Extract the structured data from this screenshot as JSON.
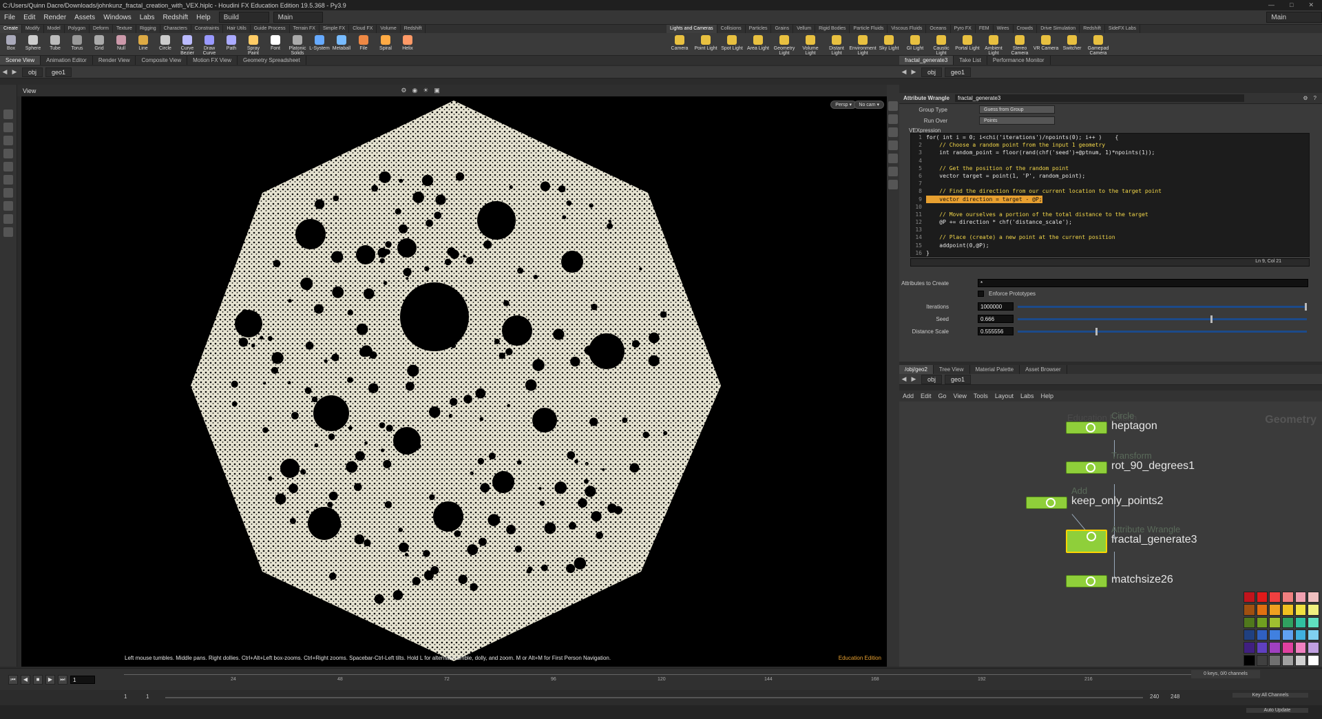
{
  "titlebar": {
    "title": "C:/Users/Quinn Dacre/Downloads/johnkunz_fractal_creation_with_VEX.hiplc - Houdini FX Education Edition 19.5.368 - Py3.9"
  },
  "menu": {
    "items": [
      "File",
      "Edit",
      "Render",
      "Assets",
      "Windows",
      "Labs",
      "Redshift",
      "Help"
    ],
    "desktop": "Build",
    "main": "Main",
    "right": "Main"
  },
  "shelf_tabs_left": [
    "Create",
    "Modify",
    "Model",
    "Polygon",
    "Deform",
    "Texture",
    "Rigging",
    "Characters",
    "Constraints",
    "Hair Utils",
    "Guide Process",
    "Terrain FX",
    "Simple FX",
    "Cloud FX",
    "Volume",
    "Redshift"
  ],
  "shelf_tabs_right": [
    "Lights and Cameras",
    "Collisions",
    "Particles",
    "Grains",
    "Vellum",
    "Rigid Bodies",
    "Particle Fluids",
    "Viscous Fluids",
    "Oceans",
    "Pyro FX",
    "FEM",
    "Wires",
    "Crowds",
    "Drive Simulation",
    "Redshift",
    "SideFX Labs"
  ],
  "tools_left": [
    "Box",
    "Sphere",
    "Tube",
    "Torus",
    "Grid",
    "Null",
    "Line",
    "Circle",
    "Curve Bezier",
    "Draw Curve",
    "Path",
    "Spray Paint",
    "Font",
    "Platonic Solids",
    "L-System",
    "Metaball",
    "File",
    "Spiral",
    "Helix"
  ],
  "tools_right": [
    "Camera",
    "Point Light",
    "Spot Light",
    "Area Light",
    "Geometry Light",
    "Volume Light",
    "Distant Light",
    "Environment Light",
    "Sky Light",
    "GI Light",
    "Caustic Light",
    "Portal Light",
    "Ambient Light",
    "Stereo Camera",
    "VR Camera",
    "Switcher",
    "Gamepad Camera"
  ],
  "pane_tabs_left": [
    "Scene View",
    "Animation Editor",
    "Render View",
    "Composite View",
    "Motion FX View",
    "Geometry Spreadsheet"
  ],
  "pane_tabs_right": [
    "fractal_generate3",
    "Take List",
    "Performance Monitor"
  ],
  "pane_tabs_net": [
    "/obj/geo2",
    "Tree View",
    "Material Palette",
    "Asset Browser"
  ],
  "path": {
    "obj": "obj",
    "geo": "geo1"
  },
  "viewport": {
    "label": "View",
    "persp": "Persp",
    "cam": "No cam",
    "hint": "Left mouse tumbles. Middle pans. Right dollies. Ctrl+Alt+Left box-zooms. Ctrl+Right zooms. Spacebar-Ctrl-Left tilts. Hold L for alternate tumble, dolly, and zoom.    M or Alt+M for First Person Navigation.",
    "edition": "Education Edition"
  },
  "params": {
    "node_type": "Attribute Wrangle",
    "node_name": "fractal_generate3",
    "group_type_label": "Group Type",
    "group_type": "Guess from Group",
    "run_over_label": "Run Over",
    "run_over": "Points",
    "vex_label": "VEXpression",
    "cursor": "Ln 9, Col 21",
    "attrs_label": "Attributes to Create",
    "attrs": "*",
    "enforce_label": "Enforce Prototypes",
    "iter_label": "Iterations",
    "iter": "1000000",
    "iter_frac": 1.0,
    "seed_label": "Seed",
    "seed": "0.666",
    "seed_frac": 0.666,
    "dist_label": "Distance Scale",
    "dist": "0.555556",
    "dist_frac": 0.27
  },
  "code": [
    {
      "n": "1",
      "t": "for( int i = 0; i<chi('iterations')/npoints(0); i++ )    {",
      "c": false
    },
    {
      "n": "2",
      "t": "    // Choose a random point from the input 1 geometry",
      "c": true
    },
    {
      "n": "3",
      "t": "    int random_point = floor(rand(chf('seed')+@ptnum, 1)*npoints(1));",
      "c": false
    },
    {
      "n": "4",
      "t": "",
      "c": false
    },
    {
      "n": "5",
      "t": "    // Get the position of the random point",
      "c": true
    },
    {
      "n": "6",
      "t": "    vector target = point(1, 'P', random_point);",
      "c": false
    },
    {
      "n": "7",
      "t": "",
      "c": false
    },
    {
      "n": "8",
      "t": "    // Find the direction from our current location to the target point",
      "c": true
    },
    {
      "n": "9",
      "t": "    vector direction = target - @P;",
      "c": false,
      "h": true
    },
    {
      "n": "10",
      "t": "",
      "c": false
    },
    {
      "n": "11",
      "t": "    // Move ourselves a portion of the total distance to the target",
      "c": true
    },
    {
      "n": "12",
      "t": "    @P += direction * chf('distance_scale');",
      "c": false
    },
    {
      "n": "13",
      "t": "",
      "c": false
    },
    {
      "n": "14",
      "t": "    // Place (create) a new point at the current position",
      "c": true
    },
    {
      "n": "15",
      "t": "    addpoint(0,@P);",
      "c": false
    },
    {
      "n": "16",
      "t": "}",
      "c": false
    }
  ],
  "network": {
    "menu": [
      "Add",
      "Edit",
      "Go",
      "View",
      "Tools",
      "Layout",
      "Labs",
      "Help"
    ],
    "watermark": "Education Edition",
    "context": "Geometry",
    "nodes": [
      {
        "type": "Circle",
        "name": "heptagon"
      },
      {
        "type": "Transform",
        "name": "rot_90_degrees1"
      },
      {
        "type": "Add",
        "name": "keep_only_points2"
      },
      {
        "type": "Attribute Wrangle",
        "name": "fractal_generate3"
      },
      {
        "type": "",
        "name": "matchsize26"
      }
    ]
  },
  "palette": [
    "#c0141c",
    "#e01a1a",
    "#f04040",
    "#f08080",
    "#f0a0b0",
    "#f0c0c0",
    "#a05010",
    "#e07010",
    "#f0a020",
    "#f0c020",
    "#f0e040",
    "#f0f080",
    "#50781c",
    "#70a020",
    "#a0c030",
    "#30a060",
    "#30c0a0",
    "#60e0c0",
    "#204080",
    "#3060c0",
    "#4080e0",
    "#60a0f0",
    "#40b0e0",
    "#80d0f0",
    "#402080",
    "#6040c0",
    "#a040c0",
    "#e040a0",
    "#f080c0",
    "#c0a0e0",
    "#000000",
    "#404040",
    "#707070",
    "#a0a0a0",
    "#d0d0d0",
    "#ffffff"
  ],
  "timeline": {
    "frame": "1",
    "start": "1",
    "start2": "1",
    "end": "240",
    "end2": "248",
    "ticks": [
      "24",
      "48",
      "72",
      "96",
      "120",
      "144",
      "168",
      "192",
      "216"
    ],
    "keys": "0 keys, 0/0 channels",
    "key_all": "Key All Channels",
    "auto_update": "Auto Update"
  }
}
